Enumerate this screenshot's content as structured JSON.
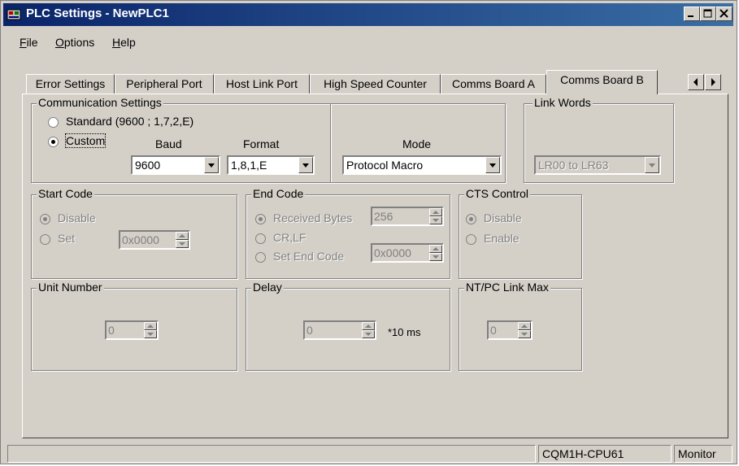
{
  "window": {
    "title": "PLC Settings - NewPLC1"
  },
  "menu": {
    "file": "File",
    "file_u": "F",
    "file_rest": "ile",
    "options_u": "O",
    "options_rest": "ptions",
    "help_u": "H",
    "help_rest": "elp"
  },
  "tabs": [
    {
      "label": "Error Settings"
    },
    {
      "label": "Peripheral Port"
    },
    {
      "label": "Host Link Port"
    },
    {
      "label": "High Speed Counter"
    },
    {
      "label": "Comms Board A"
    },
    {
      "label": "Comms Board B",
      "active": true
    }
  ],
  "comm": {
    "group_label": "Communication Settings",
    "standard_label": "Standard (9600 ; 1,7,2,E)",
    "custom_label": "Custom",
    "baud_label": "Baud",
    "baud_value": "9600",
    "format_label": "Format",
    "format_value": "1,8,1,E",
    "mode_label": "Mode",
    "mode_value": "Protocol Macro"
  },
  "link_words": {
    "group_label": "Link Words",
    "value": "LR00 to LR63"
  },
  "start_code": {
    "group_label": "Start Code",
    "disable_label": "Disable",
    "set_label": "Set",
    "value": "0x0000"
  },
  "end_code": {
    "group_label": "End Code",
    "received_label": "Received Bytes",
    "received_value": "256",
    "crlf_label": "CR,LF",
    "set_end_label": "Set End Code",
    "set_end_value": "0x0000"
  },
  "cts": {
    "group_label": "CTS Control",
    "disable_label": "Disable",
    "enable_label": "Enable"
  },
  "unit_number": {
    "group_label": "Unit Number",
    "value": "0"
  },
  "delay": {
    "group_label": "Delay",
    "value": "0",
    "unit": "*10 ms"
  },
  "ntpc": {
    "group_label": "NT/PC Link Max",
    "value": "0"
  },
  "status": {
    "cpu": "CQM1H-CPU61",
    "mode": "Monitor"
  }
}
